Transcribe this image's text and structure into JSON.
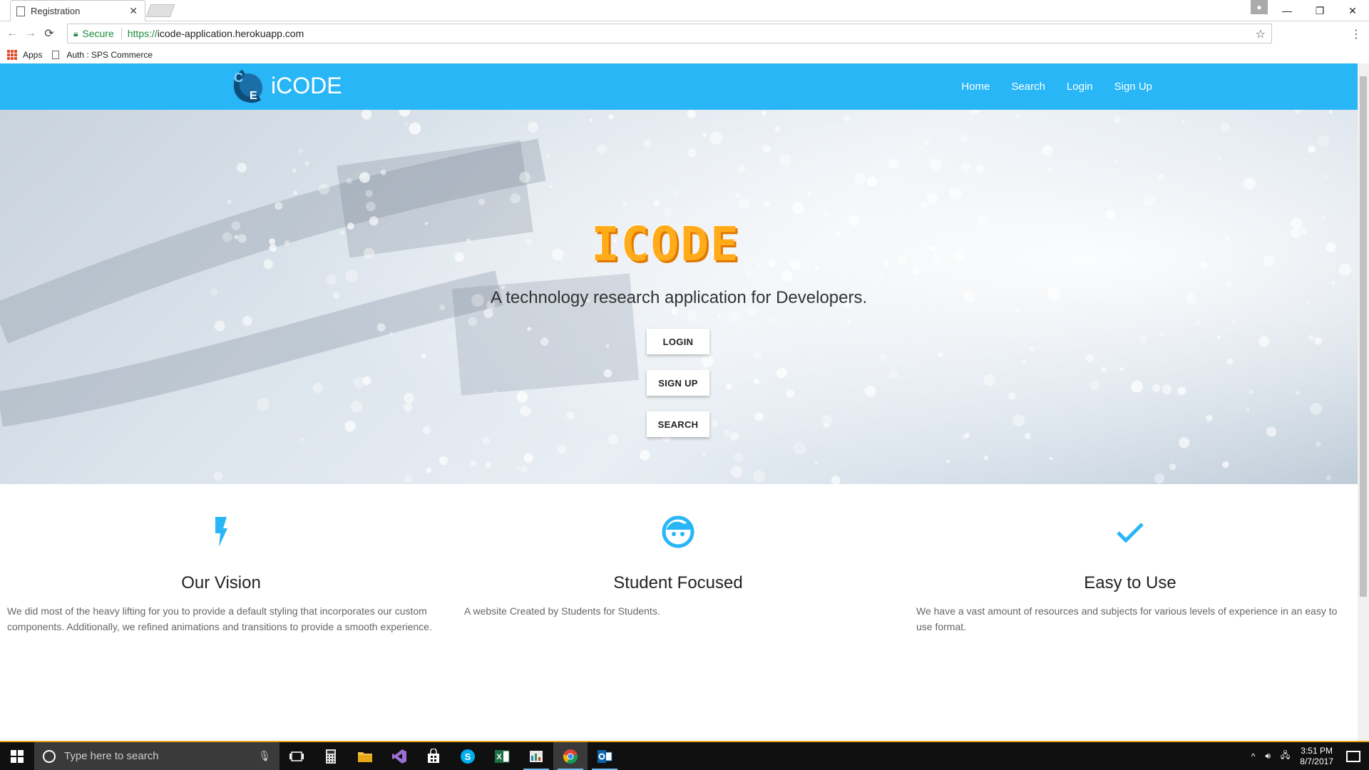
{
  "browser": {
    "tab_title": "Registration",
    "tab_close": "✕",
    "address": {
      "secure_label": "Secure",
      "url_scheme": "https://",
      "url_rest": "icode-application.herokuapp.com"
    },
    "bookmarks": [
      {
        "label": "Apps"
      },
      {
        "label": "Auth : SPS Commerce"
      }
    ]
  },
  "site": {
    "brand": "iCODE",
    "nav": [
      "Home",
      "Search",
      "Login",
      "Sign Up"
    ],
    "hero": {
      "logo_text": "ICODE",
      "tagline": "A technology research application for Developers.",
      "buttons": [
        "LOGIN",
        "SIGN UP",
        "SEARCH"
      ]
    },
    "features": [
      {
        "icon": "flash-icon",
        "title": "Our Vision",
        "text": "We did most of the heavy lifting for you to provide a default styling that incorporates our custom components. Additionally, we refined animations and transitions to provide a smooth experience."
      },
      {
        "icon": "face-icon",
        "title": "Student Focused",
        "text": "A website Created by Students for Students."
      },
      {
        "icon": "check-icon",
        "title": "Easy to Use",
        "text": "We have a vast amount of resources and subjects for various levels of experience in an easy to use format."
      }
    ],
    "colors": {
      "header": "#29b6f6",
      "accent": "#29b6f6",
      "hero_logo": "#ffab1a"
    }
  },
  "taskbar": {
    "search_placeholder": "Type here to search",
    "apps": [
      "task-view-icon",
      "calculator-icon",
      "file-explorer-icon",
      "visual-studio-icon",
      "store-icon",
      "skype-icon",
      "excel-icon",
      "app-icon",
      "chrome-icon",
      "outlook-icon"
    ],
    "time": "3:51 PM",
    "date": "8/7/2017"
  }
}
